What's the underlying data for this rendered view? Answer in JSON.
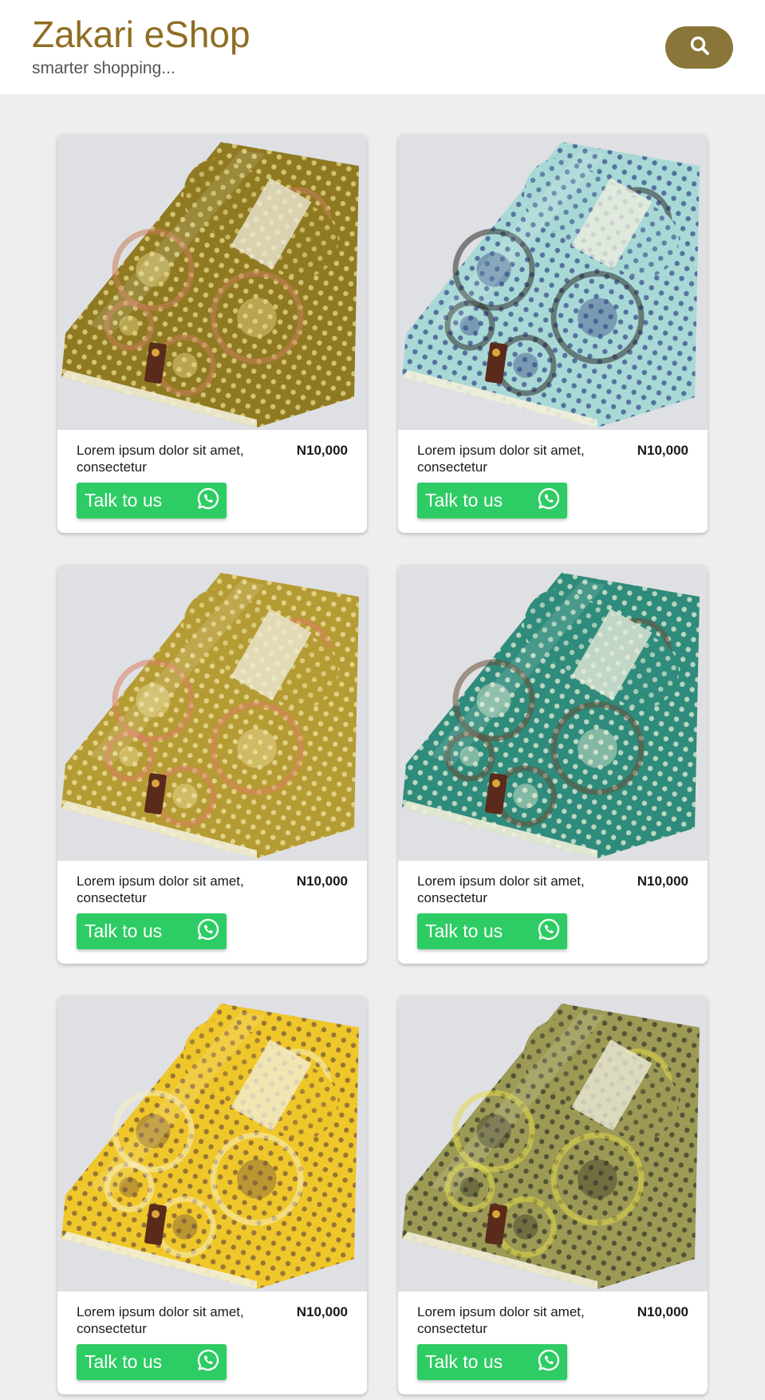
{
  "header": {
    "title": "Zakari eShop",
    "tagline": "smarter shopping...",
    "search_icon": "search-icon"
  },
  "products": [
    {
      "title": "Lorem ipsum dolor sit amet, consectetur",
      "price": "N10,000",
      "cta": "Talk to us",
      "cta_icon": "whatsapp-icon",
      "fabric_base": "#8f7a22",
      "fabric_pattern": "#e8d98a",
      "fabric_accent": "#c97b5a"
    },
    {
      "title": "Lorem ipsum dolor sit amet, consectetur",
      "price": "N10,000",
      "cta": "Talk to us",
      "cta_icon": "whatsapp-icon",
      "fabric_base": "#a9d9d6",
      "fabric_pattern": "#3c4f8a",
      "fabric_accent": "#2b2b2b"
    },
    {
      "title": "Lorem ipsum dolor sit amet, consectetur",
      "price": "N10,000",
      "cta": "Talk to us",
      "cta_icon": "whatsapp-icon",
      "fabric_base": "#b59b34",
      "fabric_pattern": "#f0e3a0",
      "fabric_accent": "#d98062"
    },
    {
      "title": "Lorem ipsum dolor sit amet, consectetur",
      "price": "N10,000",
      "cta": "Talk to us",
      "cta_icon": "whatsapp-icon",
      "fabric_base": "#2f8b7b",
      "fabric_pattern": "#e8efd8",
      "fabric_accent": "#6a4e3a"
    },
    {
      "title": "Lorem ipsum dolor sit amet, consectetur",
      "price": "N10,000",
      "cta": "Talk to us",
      "cta_icon": "whatsapp-icon",
      "fabric_base": "#f0c72a",
      "fabric_pattern": "#7a5a3a",
      "fabric_accent": "#f7efc2"
    },
    {
      "title": "Lorem ipsum dolor sit amet, consectetur",
      "price": "N10,000",
      "cta": "Talk to us",
      "cta_icon": "whatsapp-icon",
      "fabric_base": "#9c9a55",
      "fabric_pattern": "#3a3a2a",
      "fabric_accent": "#e2d94a"
    }
  ],
  "colors": {
    "brand": "#8f6d22",
    "search_button": "#8a7639",
    "cta": "#2ecc64",
    "page_bg": "#efeeee"
  }
}
